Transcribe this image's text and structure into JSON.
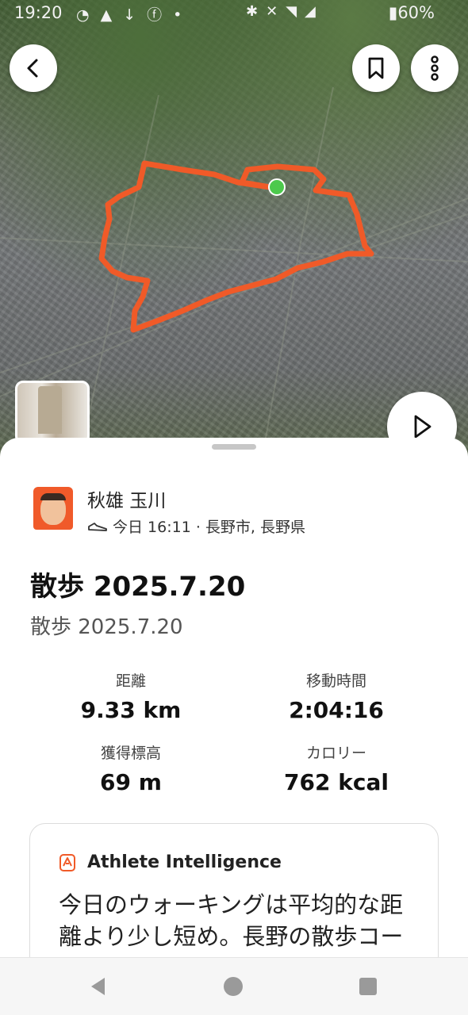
{
  "status_bar": {
    "time": "19:20",
    "battery": "60%",
    "left_icons": [
      "messenger-icon",
      "warning-icon",
      "download-icon",
      "facebook-icon",
      "dot-icon"
    ],
    "right_icons": [
      "bluetooth-icon",
      "mute-icon",
      "wifi-icon",
      "signal-icon",
      "battery-icon"
    ]
  },
  "map": {
    "route_color": "#f05a28",
    "start_marker_color": "#4cc94c"
  },
  "header": {
    "back_icon": "chevron-left-icon",
    "bookmark_icon": "bookmark-icon",
    "more_icon": "more-vertical-icon",
    "play_icon": "play-icon"
  },
  "athlete": {
    "name": "秋雄 玉川",
    "meta": "今日 16:11 · 長野市, 長野県",
    "activity_icon": "shoe-icon"
  },
  "activity": {
    "title": "散歩 2025.7.20",
    "description": "散歩 2025.7.20"
  },
  "stats": [
    {
      "label": "距離",
      "value": "9.33 km"
    },
    {
      "label": "移動時間",
      "value": "2:04:16"
    },
    {
      "label": "獲得標高",
      "value": "69 m"
    },
    {
      "label": "カロリー",
      "value": "762 kcal"
    }
  ],
  "athlete_intelligence": {
    "title": "Athlete Intelligence",
    "text": "今日のウォーキングは平均的な距離より少し短め。長野の散歩コースは、まだまだたくさん"
  },
  "nav_bar": {
    "back_icon": "triangle-back-icon",
    "home_icon": "circle-home-icon",
    "recents_icon": "square-recents-icon"
  }
}
